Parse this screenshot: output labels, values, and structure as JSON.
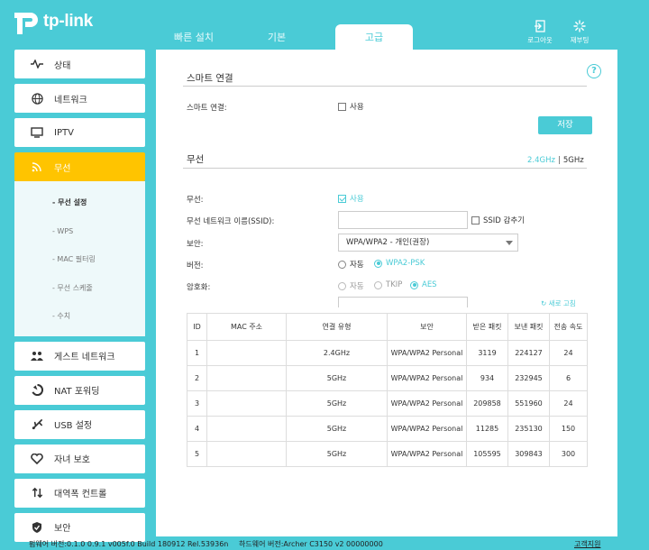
{
  "header": {
    "brand": "tp-link",
    "tabs": [
      {
        "label": "빠른 설치"
      },
      {
        "label": "기본"
      },
      {
        "label": "고급"
      }
    ],
    "logout_label": "로그아웃",
    "reboot_label": "재부팅"
  },
  "sidebar": {
    "items": [
      {
        "label": "상태",
        "icon": "pulse-icon"
      },
      {
        "label": "네트워크",
        "icon": "globe-icon"
      },
      {
        "label": "IPTV",
        "icon": "tv-icon"
      },
      {
        "label": "무선",
        "icon": "wifi-icon"
      },
      {
        "label": "게스트 네트워크",
        "icon": "guest-icon"
      },
      {
        "label": "NAT 포워딩",
        "icon": "nat-icon"
      },
      {
        "label": "USB 설정",
        "icon": "usb-icon"
      },
      {
        "label": "자녀 보호",
        "icon": "heart-icon"
      },
      {
        "label": "대역폭 컨트롤",
        "icon": "arrows-icon"
      },
      {
        "label": "보안",
        "icon": "shield-icon"
      }
    ],
    "wireless_sub": [
      {
        "label": "- 무선 설정"
      },
      {
        "label": "- WPS"
      },
      {
        "label": "- MAC 필터링"
      },
      {
        "label": "- 무선 스케줄"
      },
      {
        "label": "- 수치"
      }
    ]
  },
  "smart_connect": {
    "title": "스마트 연결",
    "label": "스마트 연결:",
    "option": "사용",
    "save_label": "저장"
  },
  "wireless": {
    "title": "무선",
    "band_24": "2.4GHz",
    "band_sep": "|",
    "band_5": "5GHz",
    "enable_label": "무선:",
    "enable_option": "사용",
    "ssid_label": "무선 네트워크 이름(SSID):",
    "ssid_value": "",
    "hide_ssid": "SSID 감추기",
    "security_label": "보안:",
    "security_value": "WPA/WPA2 - 개인(권장)",
    "version_label": "버전:",
    "version_auto": "자동",
    "version_psk": "WPA2-PSK",
    "encryption_label": "암호화:",
    "enc_auto": "자동",
    "enc_tkip": "TKIP",
    "enc_aes": "AES",
    "refresh_label": "새로 고침"
  },
  "clients_table": {
    "headers": [
      "ID",
      "MAC 주소",
      "연결 유형",
      "보안",
      "받은 패킷",
      "보낸 패킷",
      "전송 속도"
    ],
    "rows": [
      [
        "1",
        "",
        "2.4GHz",
        "WPA/WPA2 Personal",
        "3119",
        "224127",
        "24"
      ],
      [
        "2",
        "",
        "5GHz",
        "WPA/WPA2 Personal",
        "934",
        "232945",
        "6"
      ],
      [
        "3",
        "",
        "5GHz",
        "WPA/WPA2 Personal",
        "209858",
        "551960",
        "24"
      ],
      [
        "4",
        "",
        "5GHz",
        "WPA/WPA2 Personal",
        "11285",
        "235130",
        "150"
      ],
      [
        "5",
        "",
        "5GHz",
        "WPA/WPA2 Personal",
        "105595",
        "309843",
        "300"
      ]
    ]
  },
  "footer": {
    "firmware": "펌웨어 버전:0.1.0 0.9.1 v005f.0 Build 180912 Rel.53936n",
    "hardware": "하드웨어 버전:Archer C3150 v2 00000000",
    "support": "고객지원"
  },
  "colors": {
    "accent": "#4acbd6",
    "active_nav": "#ffc400"
  }
}
